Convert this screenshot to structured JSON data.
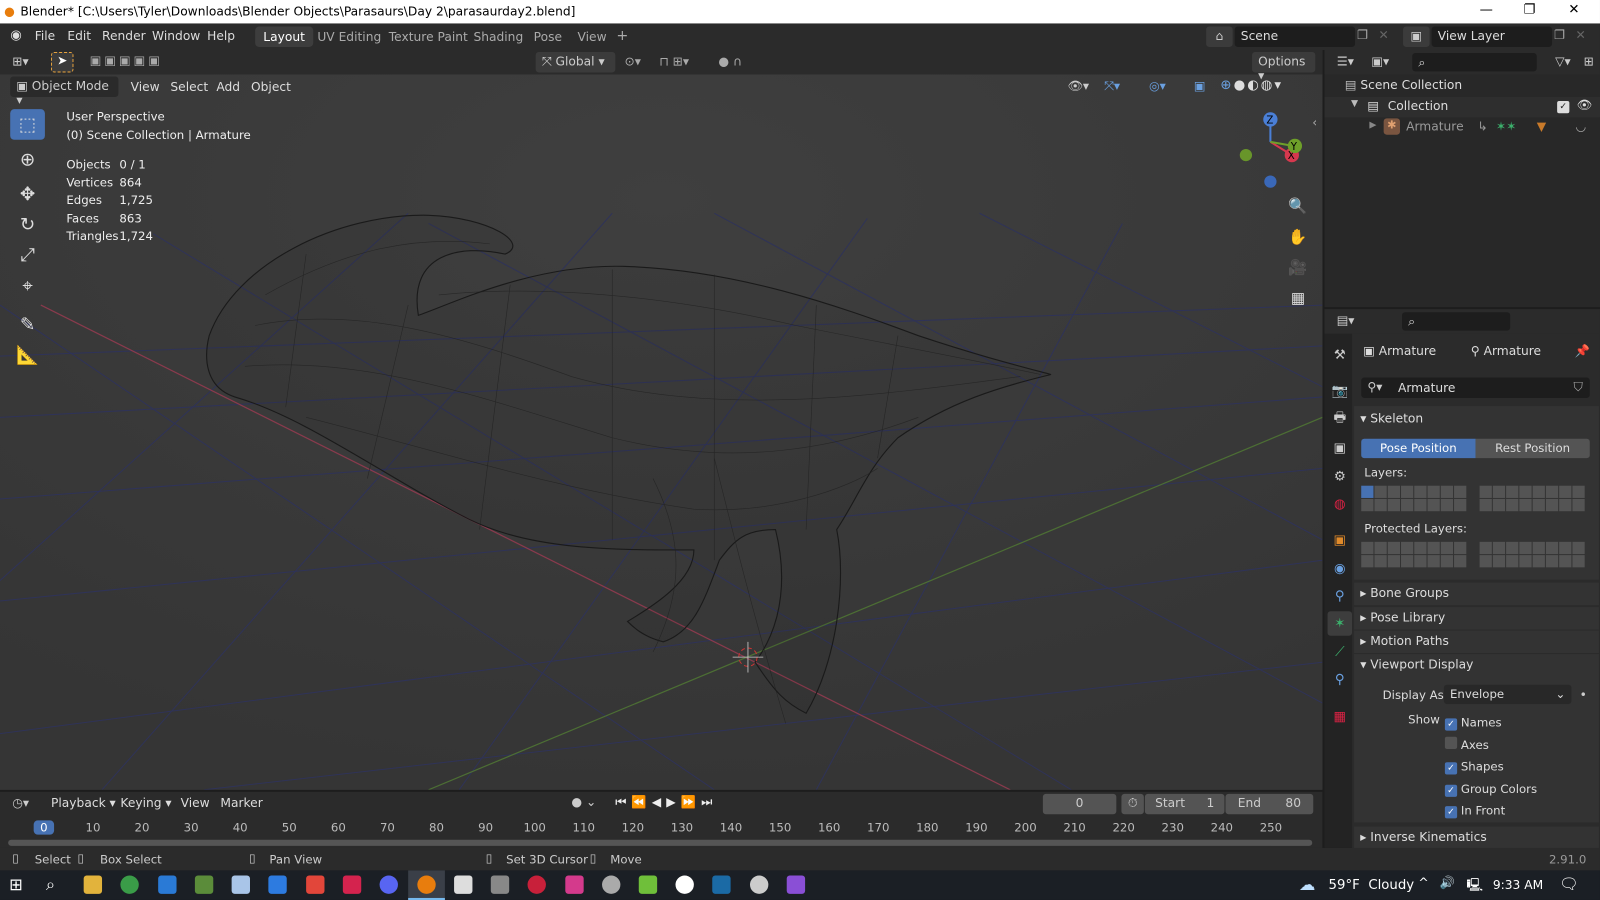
{
  "window": {
    "title": "Blender* [C:\\Users\\Tyler\\Downloads\\Blender Objects\\Parasaurs\\Day 2\\parasaurday2.blend]"
  },
  "menu": [
    "File",
    "Edit",
    "Render",
    "Window",
    "Help"
  ],
  "workspaces": [
    "Layout",
    "UV Editing",
    "Texture Paint",
    "Shading",
    "Pose",
    "View"
  ],
  "scene": "Scene",
  "view_layer": "View Layer",
  "viewport": {
    "mode": "Object Mode",
    "menus": [
      "View",
      "Select",
      "Add",
      "Object"
    ],
    "orientation": "Global",
    "options": "Options",
    "perspective": "User Perspective",
    "context": "(0) Scene Collection | Armature",
    "stats": [
      {
        "k": "Objects",
        "v": "0 / 1"
      },
      {
        "k": "Vertices",
        "v": "864"
      },
      {
        "k": "Edges",
        "v": "1,725"
      },
      {
        "k": "Faces",
        "v": "863"
      },
      {
        "k": "Triangles",
        "v": "1,724"
      }
    ],
    "gizmo": {
      "x": "X",
      "y": "Y",
      "z": "Z"
    }
  },
  "outliner": {
    "items": [
      "Scene Collection",
      "Collection",
      "Armature"
    ]
  },
  "properties": {
    "crumb1": "Armature",
    "crumb2": "Armature",
    "name": "Armature",
    "skeleton": "Skeleton",
    "pose_position": "Pose Position",
    "rest_position": "Rest Position",
    "layers": "Layers:",
    "protected_layers": "Protected Layers:",
    "bone_groups": "Bone Groups",
    "pose_library": "Pose Library",
    "motion_paths": "Motion Paths",
    "viewport_display": "Viewport Display",
    "display_as_label": "Display As",
    "display_as": "Envelope",
    "show_label": "Show",
    "show": [
      {
        "label": "Names",
        "checked": true
      },
      {
        "label": "Axes",
        "checked": false
      },
      {
        "label": "Shapes",
        "checked": true
      },
      {
        "label": "Group Colors",
        "checked": true
      },
      {
        "label": "In Front",
        "checked": true
      }
    ],
    "inverse_kinematics": "Inverse Kinematics"
  },
  "timeline": {
    "menus": [
      "Playback",
      "Keying",
      "View",
      "Marker"
    ],
    "current": "0",
    "start_label": "Start",
    "start": "1",
    "end_label": "End",
    "end": "80",
    "ticks": [
      "0",
      "10",
      "20",
      "30",
      "40",
      "50",
      "60",
      "70",
      "80",
      "90",
      "100",
      "110",
      "120",
      "130",
      "140",
      "150",
      "160",
      "170",
      "180",
      "190",
      "200",
      "210",
      "220",
      "230",
      "240",
      "250"
    ]
  },
  "status": {
    "select": "Select",
    "box_select": "Box Select",
    "pan_view": "Pan View",
    "cursor": "Set 3D Cursor",
    "move": "Move",
    "version": "2.91.0"
  },
  "taskbar": {
    "temp": "59°F",
    "weather": "Cloudy",
    "time": "9:33 AM"
  }
}
